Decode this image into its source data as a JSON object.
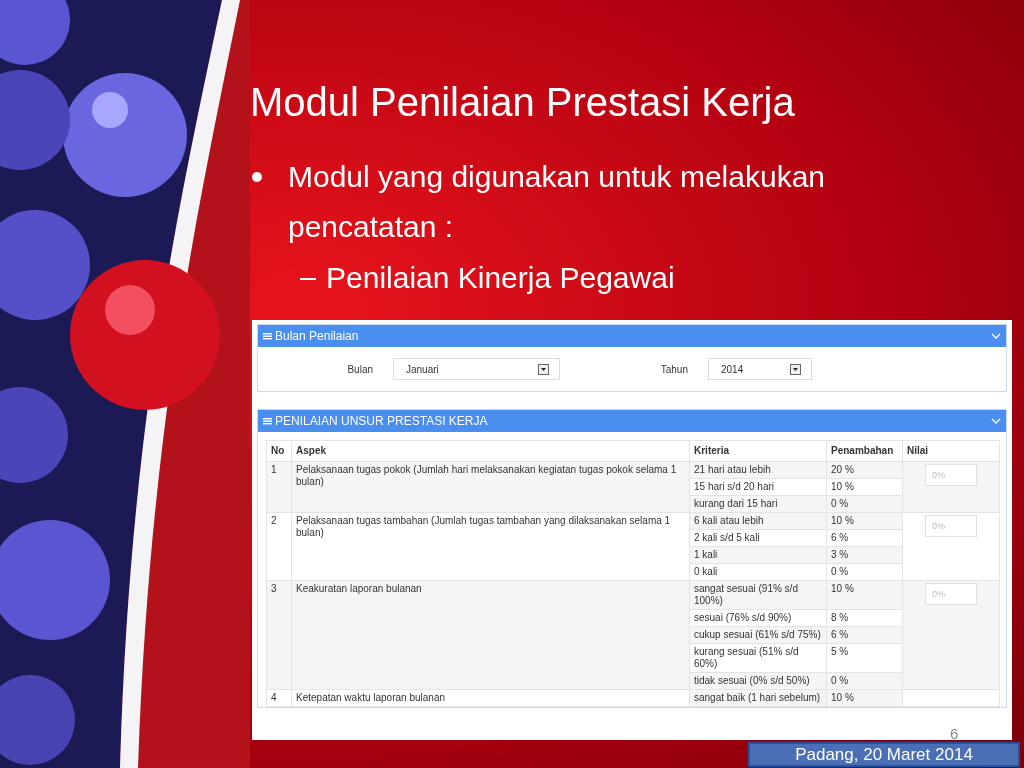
{
  "slide": {
    "title": "Modul Penilaian Prestasi Kerja",
    "bullet": "Modul yang digunakan untuk melakukan pencatatan :",
    "sub_bullet": "Penilaian Kinerja Pegawai",
    "page_number": "6",
    "footer": "Padang, 20 Maret 2014"
  },
  "bulan_panel": {
    "title": "Bulan Penilaian",
    "fields": [
      {
        "label": "Bulan",
        "value": "Januari"
      },
      {
        "label": "Tahun",
        "value": "2014"
      }
    ]
  },
  "penilaian_panel": {
    "title": "PENILAIAN UNSUR PRESTASI KERJA",
    "columns": [
      "No",
      "Aspek",
      "Kriteria",
      "Penambahan",
      "Nilai"
    ],
    "rows": [
      {
        "no": "1",
        "aspek": "Pelaksanaan tugas pokok (Jumlah hari melaksanakan kegiatan tugas pokok selama 1 bulan)",
        "nilai_placeholder": "0%",
        "criteria": [
          {
            "kriteria": "21 hari atau lebih",
            "penambahan": "20 %"
          },
          {
            "kriteria": "15 hari s/d 20 hari",
            "penambahan": "10 %"
          },
          {
            "kriteria": "kurang dari 15 hari",
            "penambahan": "0 %"
          }
        ]
      },
      {
        "no": "2",
        "aspek": "Pelaksanaan tugas tambahan (Jumlah tugas tambahan yang dilaksanakan selama 1 bulan)",
        "nilai_placeholder": "0%",
        "criteria": [
          {
            "kriteria": "6 kali atau lebih",
            "penambahan": "10 %"
          },
          {
            "kriteria": "2 kali s/d 5 kali",
            "penambahan": "6 %"
          },
          {
            "kriteria": "1 kali",
            "penambahan": "3 %"
          },
          {
            "kriteria": "0 kali",
            "penambahan": "0 %"
          }
        ]
      },
      {
        "no": "3",
        "aspek": "Keakuratan laporan bulanan",
        "nilai_placeholder": "0%",
        "criteria": [
          {
            "kriteria": "sangat sesuai (91% s/d 100%)",
            "penambahan": "10 %"
          },
          {
            "kriteria": "sesuai (76% s/d 90%)",
            "penambahan": "8 %"
          },
          {
            "kriteria": "cukup sesuai (61% s/d 75%)",
            "penambahan": "6 %"
          },
          {
            "kriteria": "kurang sesuai (51% s/d 60%)",
            "penambahan": "5 %"
          },
          {
            "kriteria": "tidak sesuai (0% s/d 50%)",
            "penambahan": "0 %"
          }
        ]
      },
      {
        "no": "4",
        "aspek": "Ketepatan waktu laporan bulanan",
        "criteria": [
          {
            "kriteria": "sangat baik (1 hari sebelum)",
            "penambahan": "10 %"
          }
        ]
      }
    ]
  }
}
